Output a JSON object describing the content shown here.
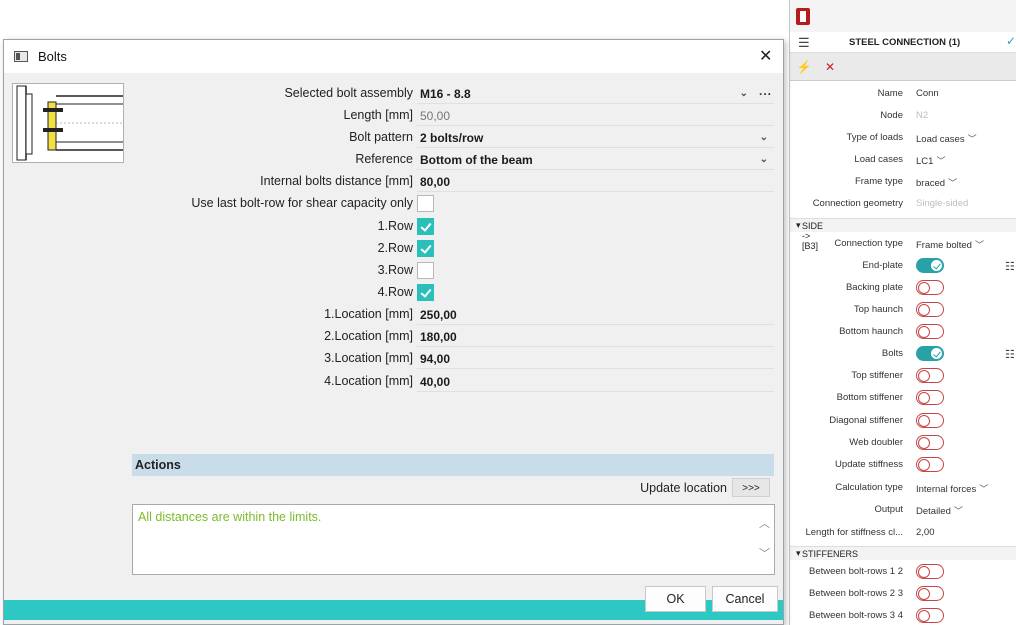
{
  "dialog": {
    "title": "Bolts",
    "fields": [
      {
        "label": "Selected bolt assembly",
        "value": "M16 - 8.8"
      },
      {
        "label": "Length [mm]",
        "value": "50,00"
      },
      {
        "label": "Bolt pattern",
        "value": "2 bolts/row"
      },
      {
        "label": "Reference",
        "value": "Bottom of the beam"
      },
      {
        "label": "Internal bolts distance [mm]",
        "value": "80,00"
      },
      {
        "label": "Use last bolt-row for shear capacity only",
        "checked": false
      },
      {
        "label": "1.Row",
        "checked": true
      },
      {
        "label": "2.Row",
        "checked": true
      },
      {
        "label": "3.Row",
        "checked": false
      },
      {
        "label": "4.Row",
        "checked": true
      },
      {
        "label": "1.Location [mm]",
        "value": "250,00"
      },
      {
        "label": "2.Location [mm]",
        "value": "180,00"
      },
      {
        "label": "3.Location [mm]",
        "value": "94,00"
      },
      {
        "label": "4.Location [mm]",
        "value": "40,00"
      }
    ],
    "more_button": "...",
    "actions_header": "Actions",
    "update_location_label": "Update location",
    "update_location_button": ">>>",
    "message": "All distances are within the limits.",
    "ok_label": "OK",
    "cancel_label": "Cancel"
  },
  "panel": {
    "title": "STEEL CONNECTION (1)",
    "rows": [
      {
        "label": "Name",
        "value": "Conn"
      },
      {
        "label": "Node",
        "value": "N2"
      },
      {
        "label": "Type of loads",
        "value": "Load cases"
      },
      {
        "label": "Load cases",
        "value": "LC1"
      },
      {
        "label": "Frame type",
        "value": "braced"
      },
      {
        "label": "Connection geometry",
        "value": "Single-sided"
      }
    ],
    "side_section": "SIDE ->[B3]",
    "connection_type_label": "Connection type",
    "connection_type_value": "Frame bolted",
    "toggles": [
      {
        "label": "End-plate",
        "on": true
      },
      {
        "label": "Backing plate",
        "on": false
      },
      {
        "label": "Top haunch",
        "on": false
      },
      {
        "label": "Bottom haunch",
        "on": false
      },
      {
        "label": "Bolts",
        "on": true
      },
      {
        "label": "Top stiffener",
        "on": false
      },
      {
        "label": "Bottom stiffener",
        "on": false
      },
      {
        "label": "Diagonal stiffener",
        "on": false
      },
      {
        "label": "Web doubler",
        "on": false
      },
      {
        "label": "Update stiffness",
        "on": false
      }
    ],
    "calc_type_label": "Calculation type",
    "calc_type_value": "Internal forces",
    "output_label": "Output",
    "output_value": "Detailed",
    "stiff_length_label": "Length for stiffness cl...",
    "stiff_length_value": "2,00",
    "stiffeners_section": "STIFFENERS",
    "between_rows": [
      {
        "label": "Between bolt-rows 1 2",
        "on": false
      },
      {
        "label": "Between bolt-rows 2 3",
        "on": false
      },
      {
        "label": "Between bolt-rows 3 4",
        "on": false
      }
    ]
  }
}
